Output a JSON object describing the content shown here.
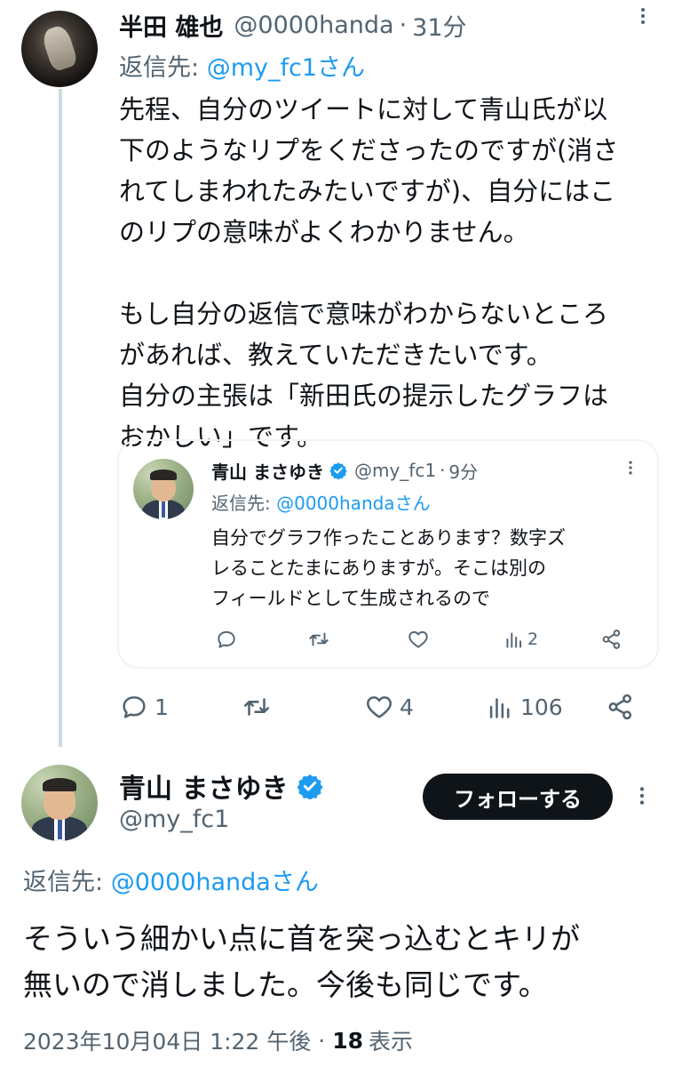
{
  "reply_tweet": {
    "display_name": "半田 雄也",
    "handle": "@0000handa",
    "separator": "·",
    "time": "31分",
    "reply_prefix": "返信先: ",
    "reply_to": "@my_fc1さん",
    "text": "先程、自分のツイートに対して青山氏が以\n下のようなリプをくださったのですが(消さ\nれてしまわれたみたいですが)、自分にはこ\nのリプの意味がよくわかりません。\n\nもし自分の返信で意味がわからないところ\nがあれば、教えていただきたいです。\n自分の主張は「新田氏の提示したグラフは\nおかしい」です。",
    "actions": {
      "replies": "1",
      "retweets": "",
      "likes": "4",
      "views": "106"
    }
  },
  "quoted_tweet": {
    "display_name": "青山 まさゆき",
    "handle": "@my_fc1",
    "separator": "·",
    "time": "9分",
    "reply_prefix": "返信先: ",
    "reply_to": "@0000handaさん",
    "text": "自分でグラフ作ったことあります？数字ズ\nレることたまにありますが。そこは別の\nフィールドとして生成されるので",
    "actions": {
      "replies": "",
      "retweets": "",
      "likes": "",
      "views": "2"
    }
  },
  "focused_tweet": {
    "display_name": "青山 まさゆき",
    "handle": "@my_fc1",
    "follow_label": "フォローする",
    "reply_prefix": "返信先: ",
    "reply_to": "@0000handaさん",
    "text": "そういう細かい点に首を突っ込むとキリが\n無いので消しました。今後も同じです。",
    "timestamp": "2023年10月04日 1:22 午後",
    "separator": "·",
    "views": "18",
    "views_label": "表示"
  },
  "colors": {
    "accent": "#1d9bf0",
    "muted": "#536471",
    "text": "#0f1419",
    "border": "#eff3f4"
  },
  "icons": [
    "reply-icon",
    "retweet-icon",
    "like-icon",
    "views-icon",
    "share-icon",
    "verified-badge-icon",
    "more-icon"
  ]
}
